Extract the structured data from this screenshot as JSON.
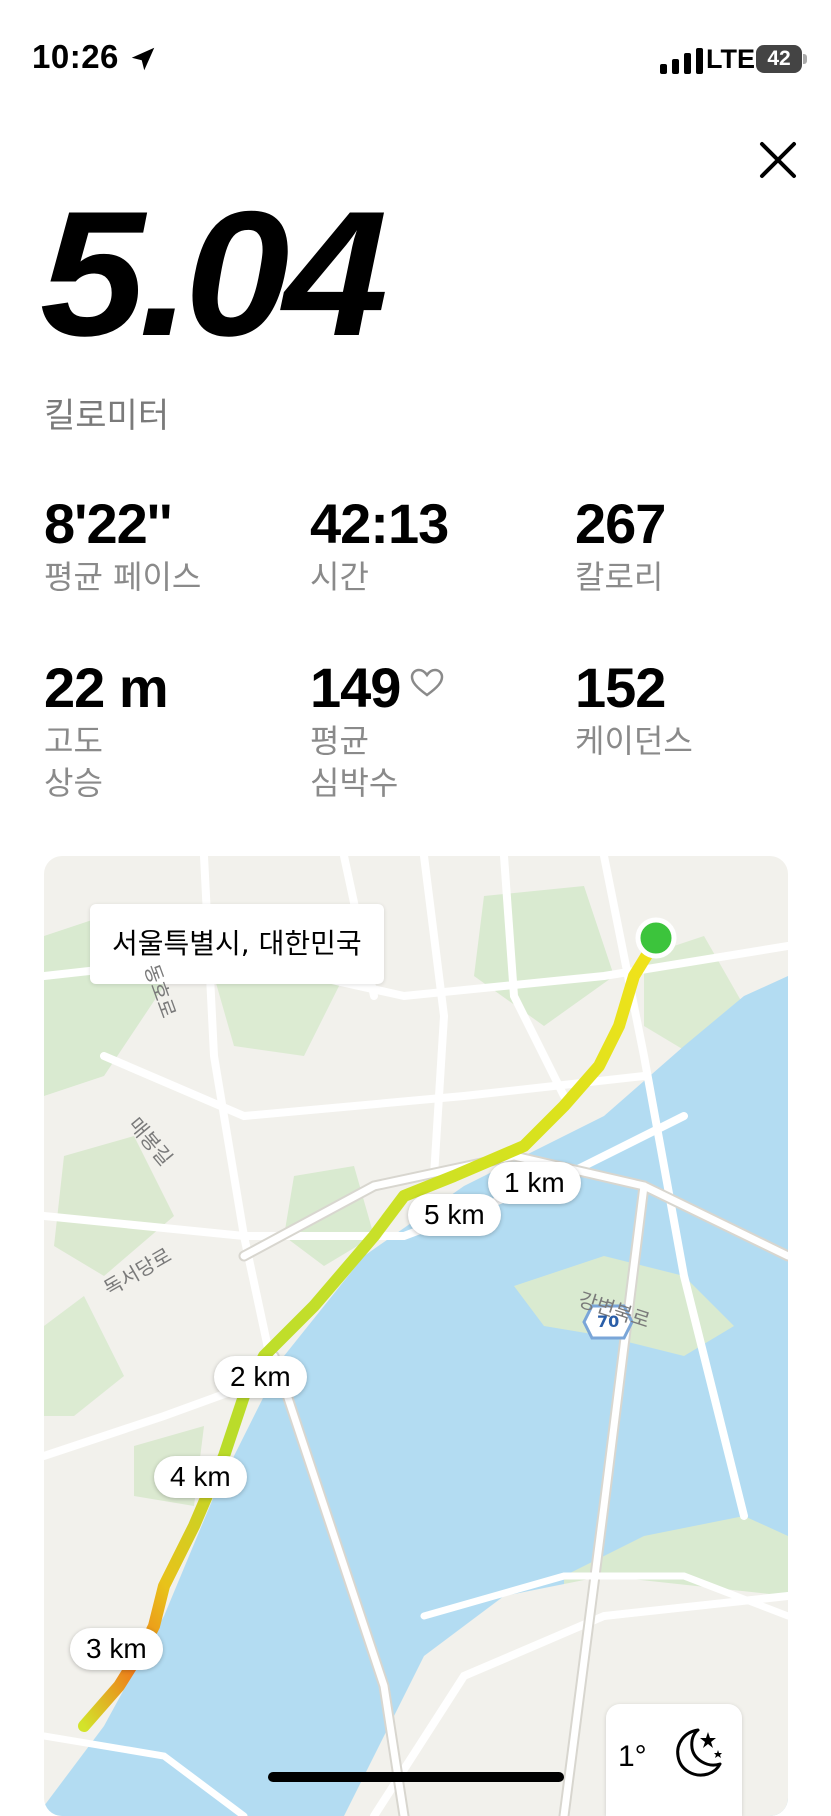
{
  "status_bar": {
    "time": "10:26",
    "network": "LTE",
    "battery": "42",
    "icons": [
      "location-arrow-icon",
      "signal-icon",
      "battery-icon"
    ]
  },
  "run": {
    "distance": "5.04",
    "distance_unit": "킬로미터",
    "stats": [
      {
        "value": "8'22''",
        "label": "평균 페이스"
      },
      {
        "value": "42:13",
        "label": "시간"
      },
      {
        "value": "267",
        "label": "칼로리"
      },
      {
        "value": "22 m",
        "label_line1": "고도",
        "label_line2": "상승"
      },
      {
        "value": "149",
        "label_line1": "평균",
        "label_line2": "심박수"
      },
      {
        "value": "152",
        "label": "케이던스"
      }
    ]
  },
  "map": {
    "location": "서울특별시, 대한민국",
    "km_markers": [
      "1 km",
      "5 km",
      "2 km",
      "4 km",
      "3 km"
    ],
    "road_labels": [
      "강변북로",
      "매봉길",
      "독서당로",
      "동호로",
      "70"
    ],
    "weather_temp": "1°",
    "colors": {
      "water": "#b3dcf2",
      "land": "#f2f1ec",
      "park": "#d9ead0",
      "start_dot": "#3cc43c",
      "route_fast": "#c7e02a",
      "route_mid": "#f2e21a",
      "route_slow": "#f07a1a"
    }
  }
}
